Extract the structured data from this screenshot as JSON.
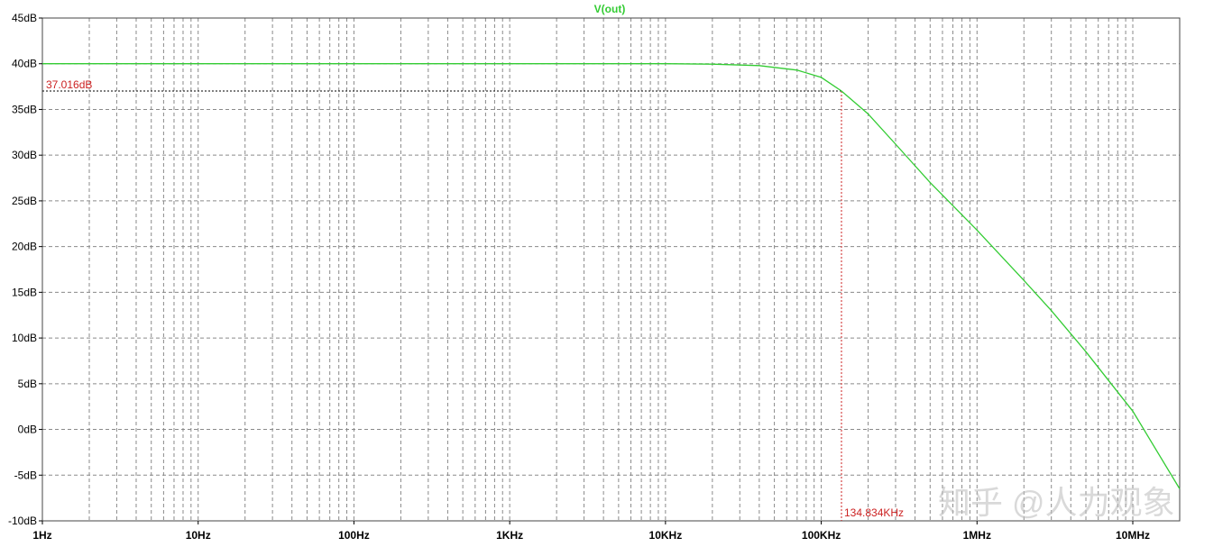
{
  "chart_data": {
    "type": "line",
    "title": "V(out)",
    "xlabel": "",
    "ylabel": "",
    "x_scale": "log",
    "xlim": [
      1,
      20000000
    ],
    "ylim": [
      -10,
      45
    ],
    "grid": true,
    "x_tick_labels": [
      "1Hz",
      "10Hz",
      "100Hz",
      "1KHz",
      "10KHz",
      "100KHz",
      "1MHz",
      "10MHz"
    ],
    "x_tick_values": [
      1,
      10,
      100,
      1000,
      10000,
      100000,
      1000000,
      10000000
    ],
    "y_tick_labels": [
      "45dB",
      "40dB",
      "35dB",
      "30dB",
      "25dB",
      "20dB",
      "15dB",
      "10dB",
      "5dB",
      "0dB",
      "-5dB",
      "-10dB"
    ],
    "y_tick_values": [
      45,
      40,
      35,
      30,
      25,
      20,
      15,
      10,
      5,
      0,
      -5,
      -10
    ],
    "series": [
      {
        "name": "V(out)",
        "color": "#33cc33",
        "points": [
          [
            1,
            40
          ],
          [
            1000,
            40
          ],
          [
            10000,
            40
          ],
          [
            20000,
            39.95
          ],
          [
            40000,
            39.8
          ],
          [
            70000,
            39.3
          ],
          [
            100000,
            38.5
          ],
          [
            134834,
            37.016
          ],
          [
            200000,
            34.5
          ],
          [
            300000,
            31.2
          ],
          [
            500000,
            27.0
          ],
          [
            1000000,
            21.8
          ],
          [
            2000000,
            16.3
          ],
          [
            3000000,
            13.0
          ],
          [
            5000000,
            8.5
          ],
          [
            10000000,
            2.0
          ],
          [
            20000000,
            -6.5
          ]
        ]
      }
    ],
    "cursor": {
      "x": 134834,
      "y": 37.016,
      "x_label": "134.834KHz",
      "y_label": "37.016dB",
      "color": "#cc2222"
    },
    "colors": {
      "grid": "#8a8a8a",
      "axis_text": "#000000",
      "background": "#ffffff"
    }
  },
  "watermark": "知乎 @人力观象"
}
